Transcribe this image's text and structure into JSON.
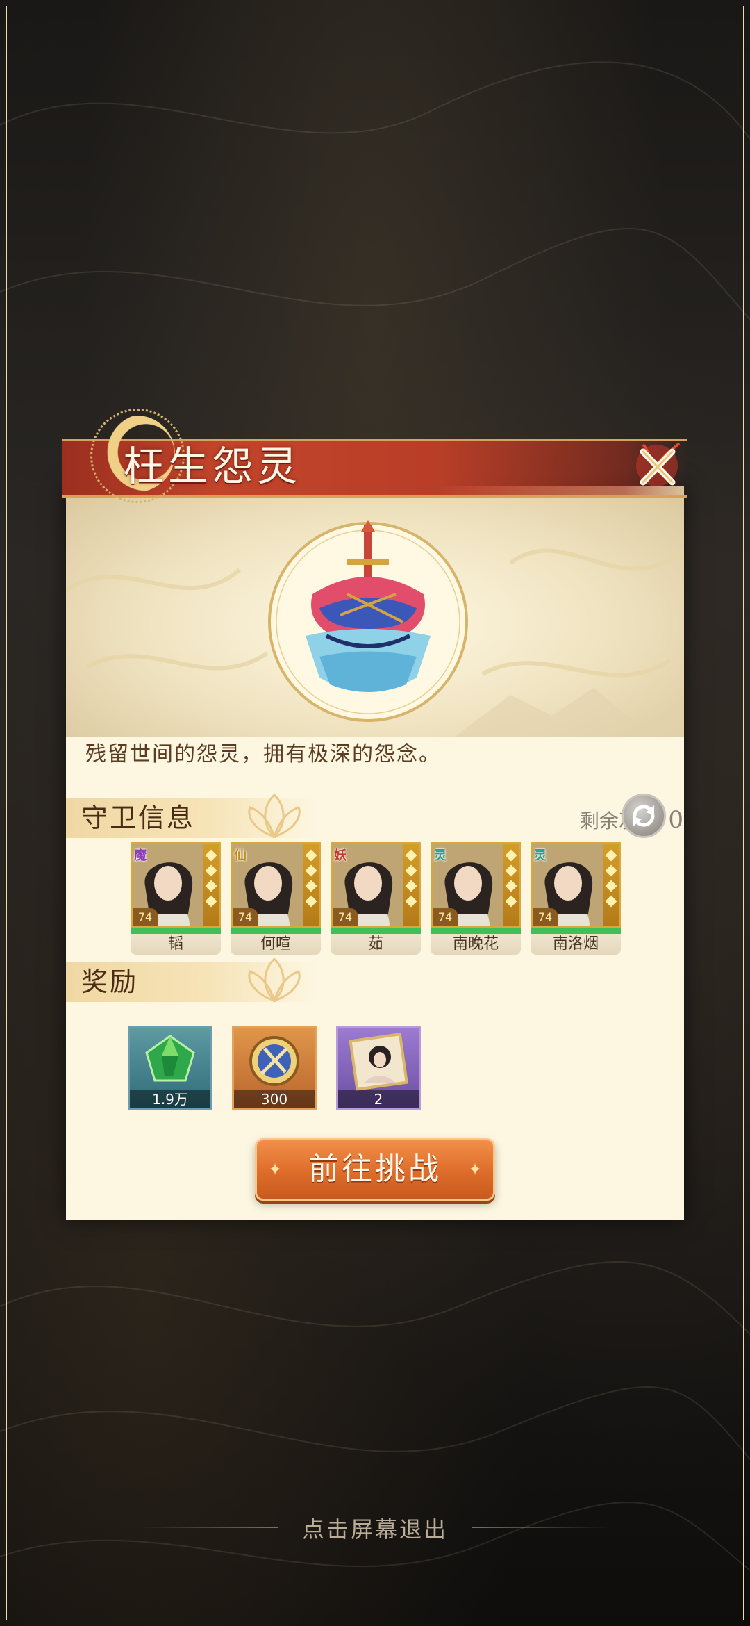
{
  "popup": {
    "title": "枉生怨灵",
    "description": "残留世间的怨灵，拥有极深的怨念。"
  },
  "guards_section": {
    "label": "守卫信息",
    "remaining_label": "剩余次数:",
    "remaining_value": "0",
    "guards": [
      {
        "name": "韬",
        "level": "74",
        "faction": "魔",
        "color": "#8a3bb8"
      },
      {
        "name": "何喧",
        "level": "74",
        "faction": "仙",
        "color": "#c28b1d"
      },
      {
        "name": "茹",
        "level": "74",
        "faction": "妖",
        "color": "#c23a2a"
      },
      {
        "name": "南晚花",
        "level": "74",
        "faction": "灵",
        "color": "#2c9b8a"
      },
      {
        "name": "南洛烟",
        "level": "74",
        "faction": "灵",
        "color": "#2c9b8a"
      }
    ]
  },
  "rewards_section": {
    "label": "奖励",
    "items": [
      {
        "icon": "jade-gem-icon",
        "count": "1.9万",
        "rarity": "green"
      },
      {
        "icon": "sword-medal-icon",
        "count": "300",
        "rarity": "orange"
      },
      {
        "icon": "character-portrait-icon",
        "count": "2",
        "rarity": "purple"
      }
    ]
  },
  "challenge_button": {
    "label": "前往挑战"
  },
  "exit_hint": "点击屏幕退出"
}
